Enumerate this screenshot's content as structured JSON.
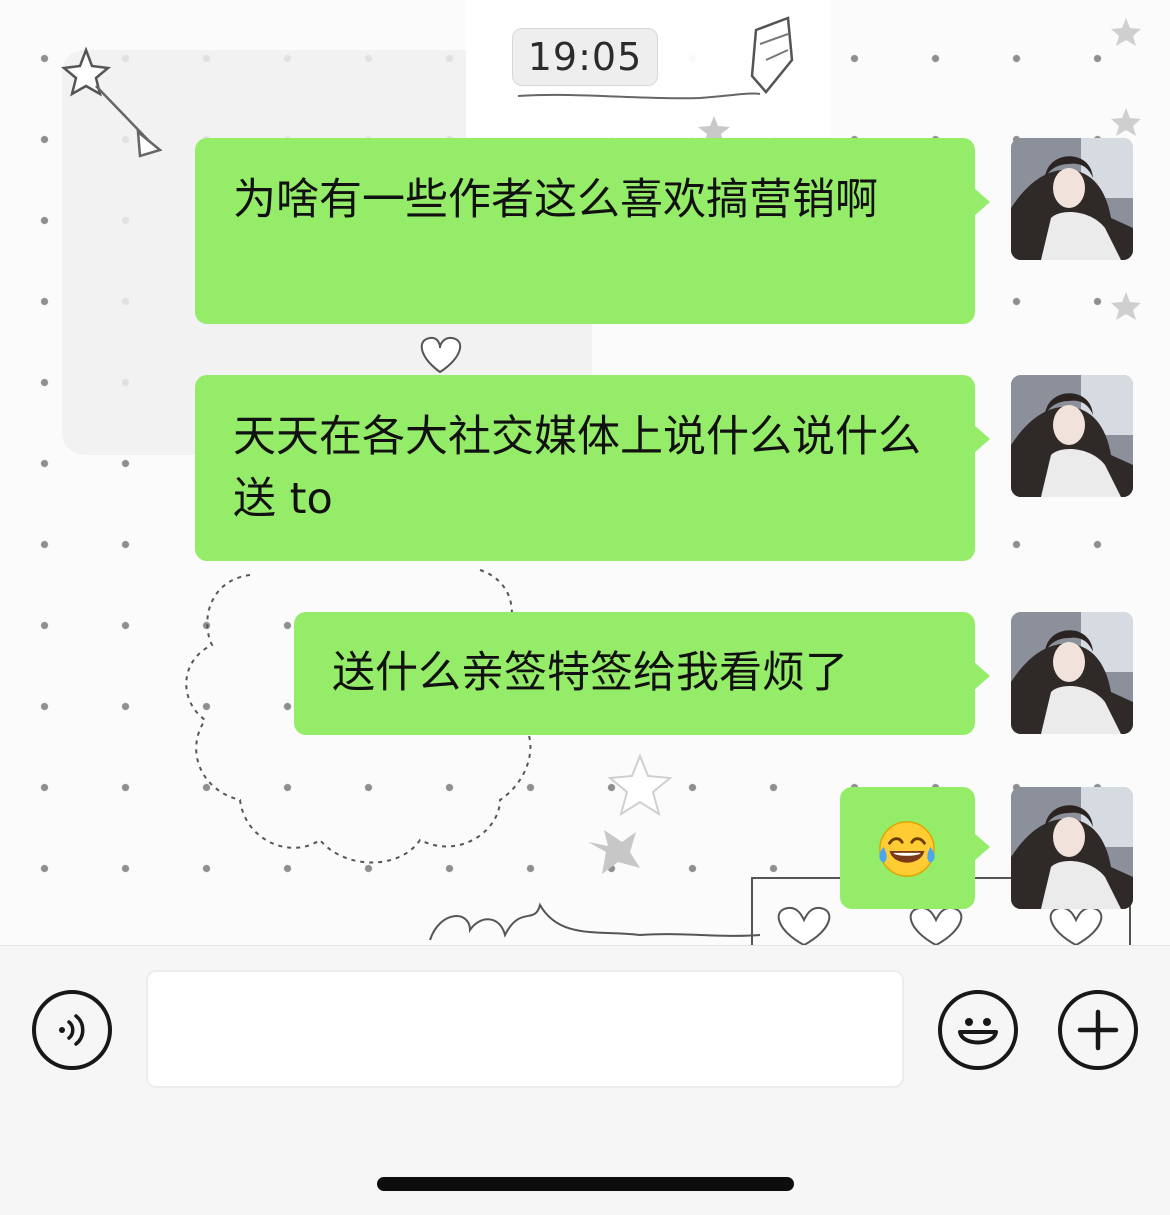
{
  "header": {
    "time": "19:05"
  },
  "messages": [
    {
      "text": "为啥有一些作者这么喜欢搞营销啊",
      "sender": "self"
    },
    {
      "text": "天天在各大社交媒体上说什么说什么送 to",
      "sender": "self"
    },
    {
      "text": "送什么亲签特签给我看烦了",
      "sender": "self"
    },
    {
      "emoji": "face-with-tears-of-joy",
      "sender": "self"
    }
  ],
  "input_bar": {
    "voice_icon": "voice-icon",
    "input_value": "",
    "emoji_icon": "smiley-icon",
    "plus_icon": "plus-icon"
  },
  "colors": {
    "bubble": "#95ec69",
    "bar_background": "#f6f6f6",
    "chat_background": "#fbfbfb"
  }
}
